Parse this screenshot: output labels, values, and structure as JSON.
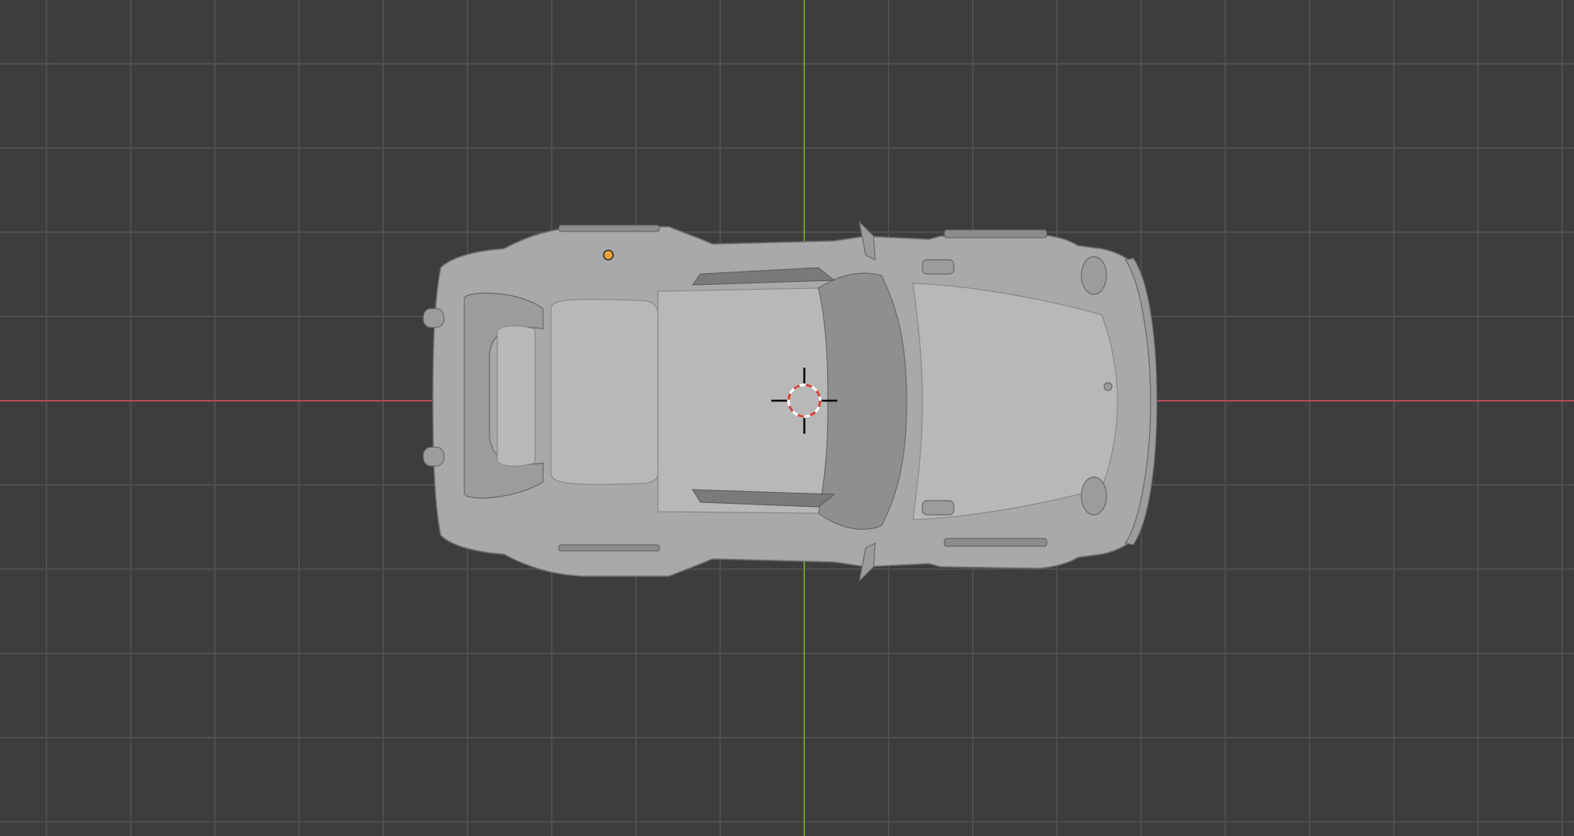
{
  "viewport": {
    "mode": "top-orthographic",
    "colors": {
      "background": "#3d3d3d",
      "grid_line": "#4f4f4f",
      "x_axis": "#b84a55",
      "y_axis": "#6a9a2a",
      "model_body": "#a9a9a9",
      "model_body_light": "#b8b8b8",
      "model_shadow": "#7a7a7a",
      "origin_dot": "#f0a33a",
      "cursor_red": "#d8443e",
      "cursor_white": "#ffffff"
    }
  },
  "objects": [
    {
      "name": "car-model",
      "selected": false
    }
  ],
  "icons": {
    "origin": "object-origin-dot-icon",
    "cursor": "3d-cursor-icon"
  }
}
